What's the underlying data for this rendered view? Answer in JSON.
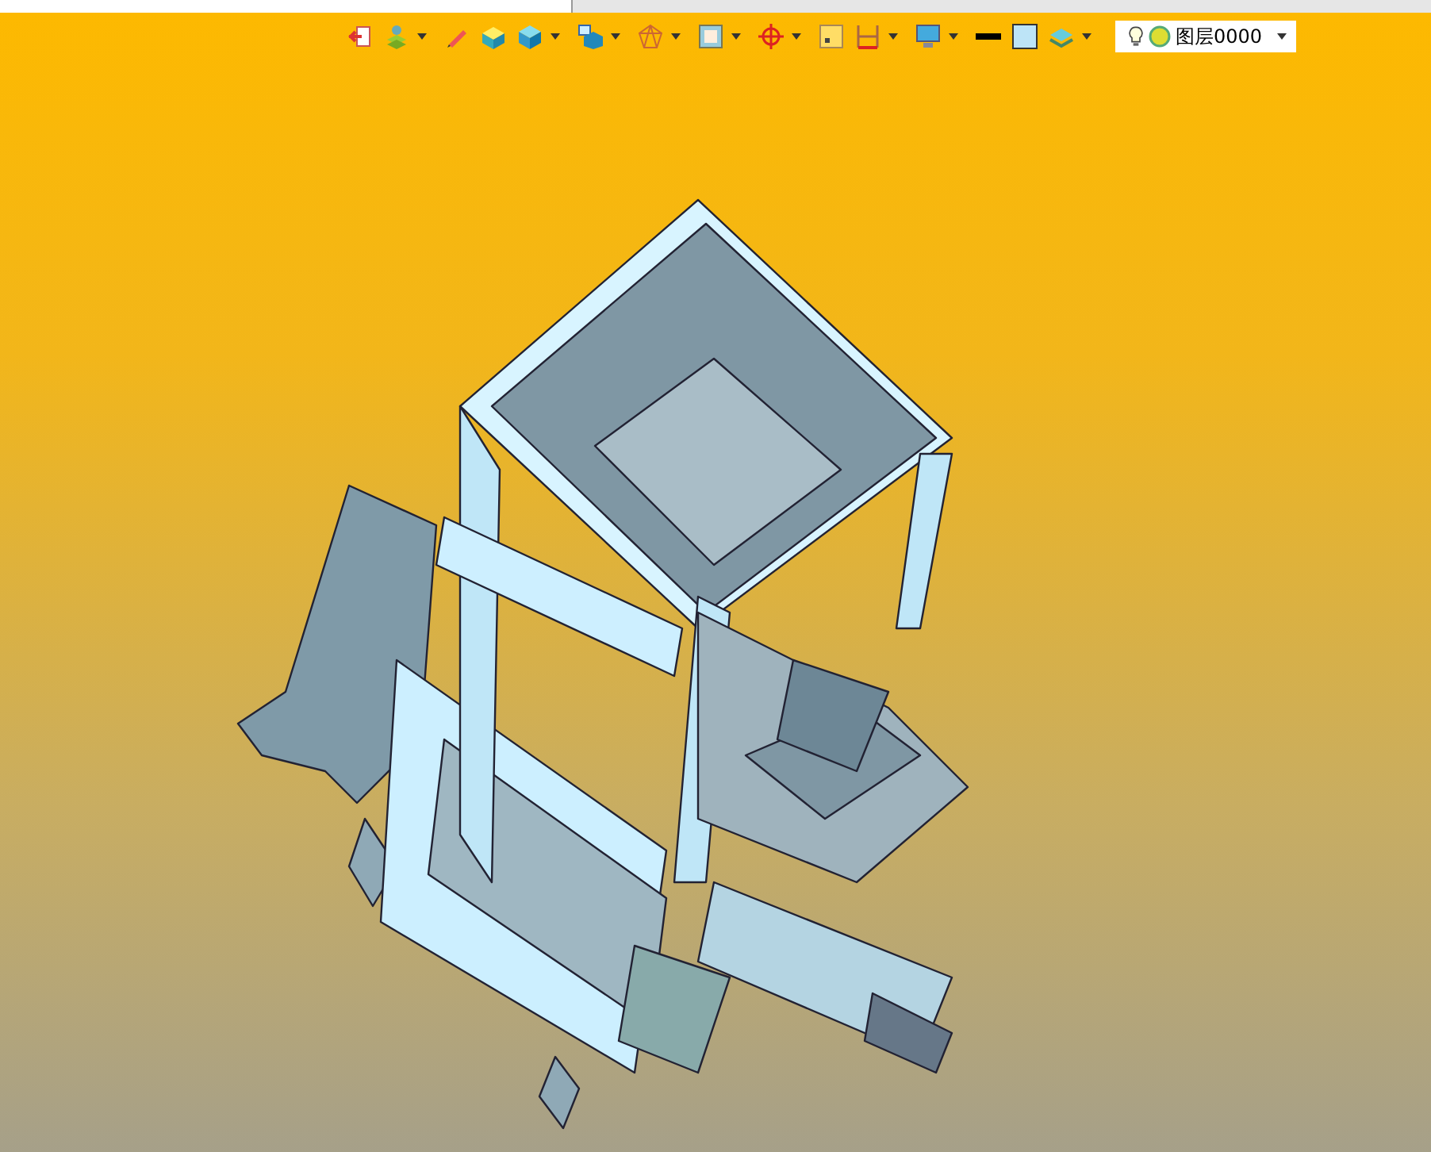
{
  "toolbar": [
    {
      "kind": "exit",
      "dropdown": false
    },
    {
      "kind": "layers",
      "dropdown": true
    },
    {
      "kind": "pen",
      "dropdown": false
    },
    {
      "kind": "box-yellow",
      "dropdown": false
    },
    {
      "kind": "cube",
      "dropdown": true
    },
    {
      "kind": "cube-view",
      "dropdown": true
    },
    {
      "kind": "wire",
      "dropdown": true
    },
    {
      "kind": "frame",
      "dropdown": true
    },
    {
      "kind": "target",
      "dropdown": true
    },
    {
      "kind": "square",
      "dropdown": false
    },
    {
      "kind": "dimension",
      "dropdown": true
    },
    {
      "kind": "monitor",
      "dropdown": true
    },
    {
      "kind": "line-black",
      "dropdown": false
    },
    {
      "kind": "fill",
      "dropdown": false
    },
    {
      "kind": "stack",
      "dropdown": true
    }
  ],
  "layer": {
    "name": "图层0000",
    "visible": true
  }
}
